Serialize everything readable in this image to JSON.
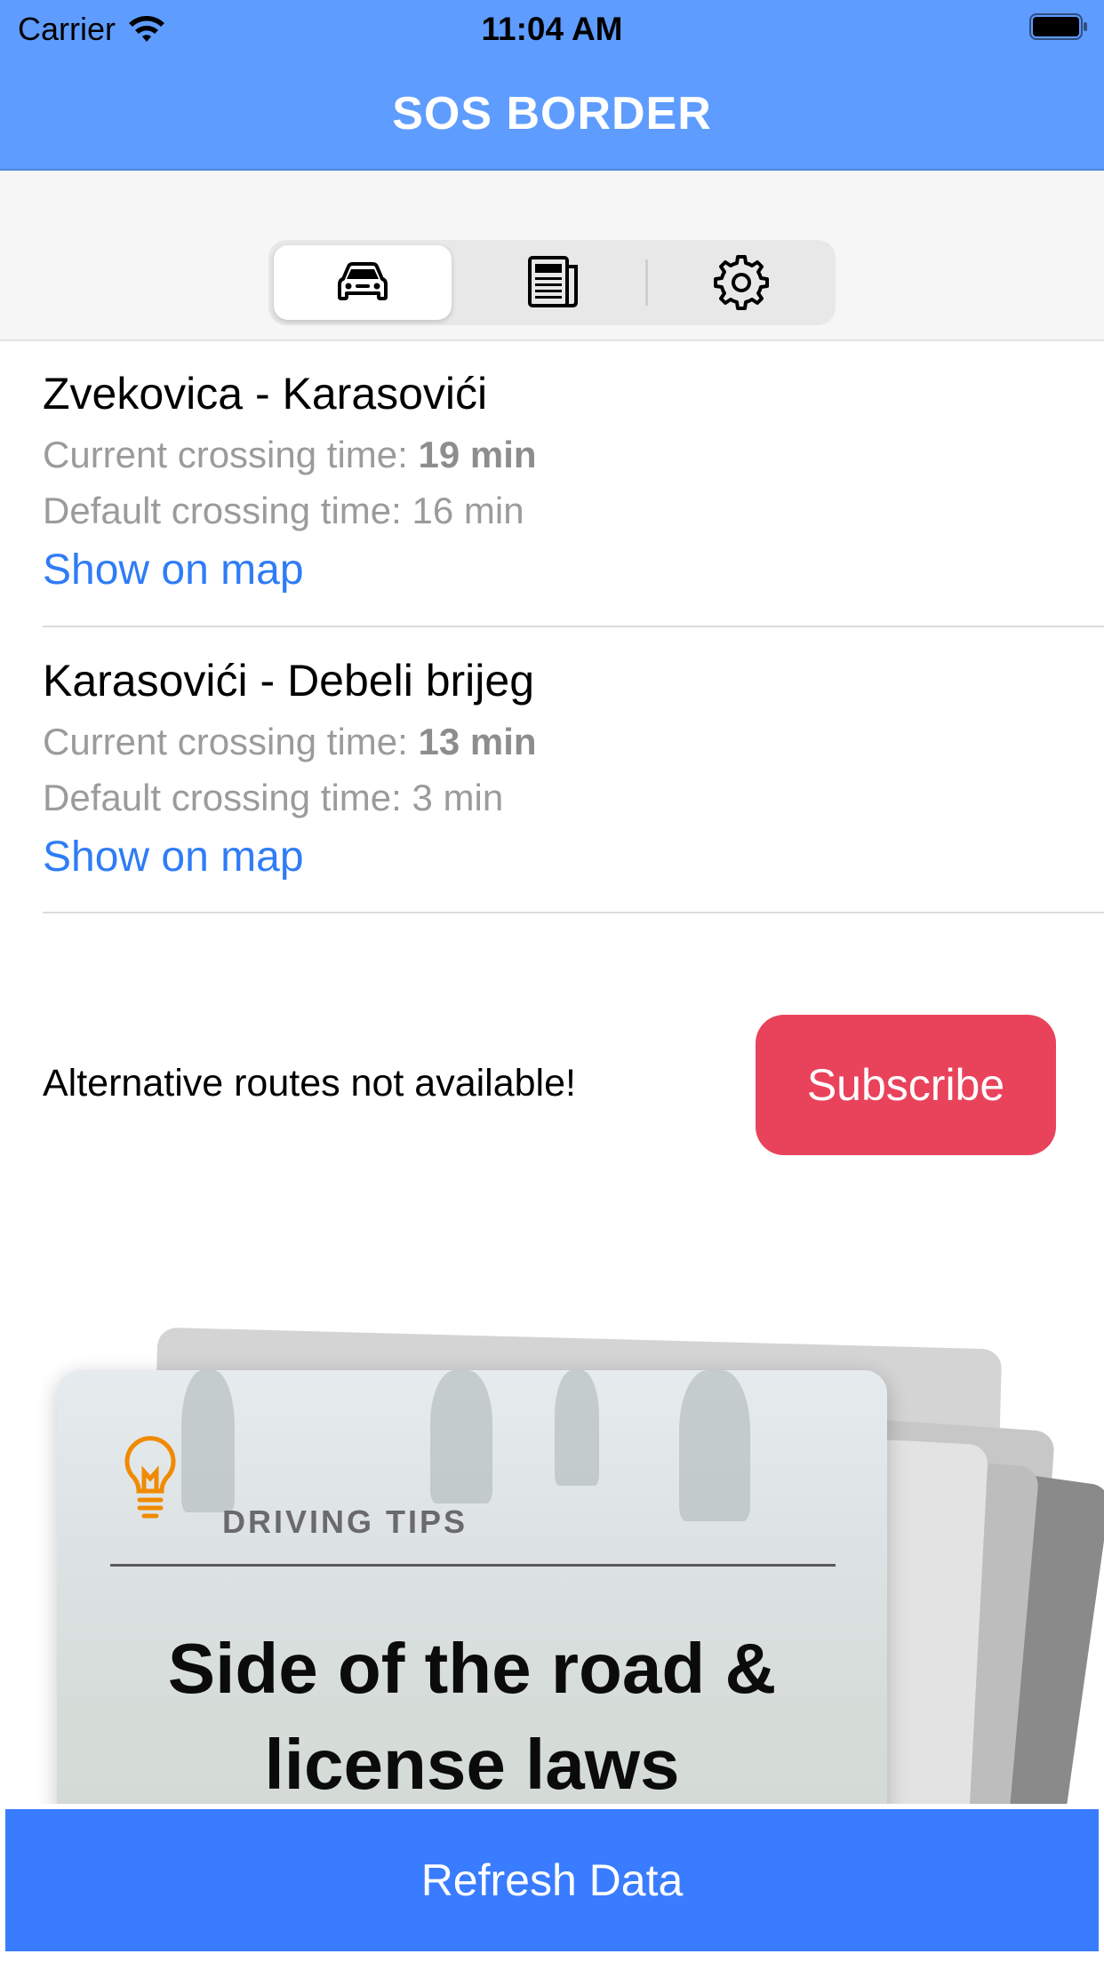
{
  "status_bar": {
    "carrier": "Carrier",
    "time": "11:04 AM"
  },
  "nav": {
    "title": "SOS BORDER"
  },
  "tabs": [
    {
      "icon": "car-icon",
      "active": true
    },
    {
      "icon": "newspaper-icon",
      "active": false
    },
    {
      "icon": "gear-icon",
      "active": false
    }
  ],
  "crossings": [
    {
      "name": "Zvekovica - Karasovići",
      "current_label": "Current crossing time: ",
      "current_value": "19 min",
      "default_label": "Default crossing time: 16 min",
      "link": "Show on map"
    },
    {
      "name": "Karasovići - Debeli brijeg",
      "current_label": "Current crossing time: ",
      "current_value": "13 min",
      "default_label": "Default crossing time: 3 min",
      "link": "Show on map"
    }
  ],
  "alternative": {
    "text": "Alternative routes not available!",
    "button": "Subscribe"
  },
  "tip_card": {
    "category": "DRIVING TIPS",
    "title": "Side of the road & license laws",
    "icon": "lightbulb-icon"
  },
  "footer": {
    "button": "Refresh Data"
  },
  "colors": {
    "nav_bg": "#5e9cff",
    "link": "#2f7cf6",
    "subscribe": "#e9435c",
    "refresh": "#3a7cff",
    "bulb": "#f08a00"
  }
}
